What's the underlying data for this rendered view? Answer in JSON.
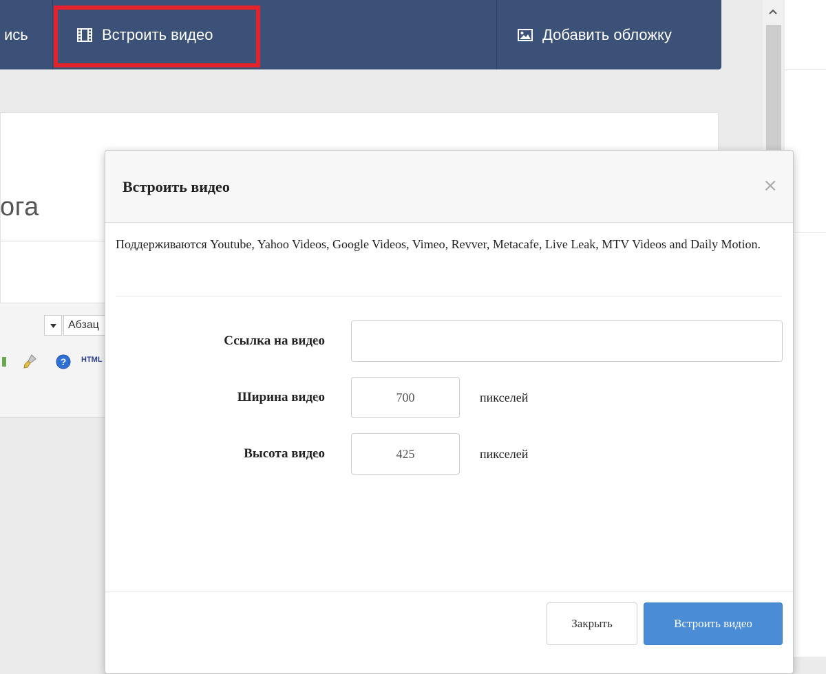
{
  "topbar": {
    "left_cut_label": "ись",
    "embed_video_label": "Встроить видео",
    "add_cover_label": "Добавить обложку"
  },
  "editor": {
    "title_fragment": "ога",
    "format_select_fragment": "Абзац",
    "html_label": "HTML"
  },
  "modal": {
    "title": "Встроить видео",
    "close_symbol": "×",
    "description": "Поддерживаются Youtube, Yahoo Videos, Google Videos, Vimeo, Revver, Metacafe, Live Leak, MTV Videos and Daily Motion.",
    "fields": {
      "url": {
        "label": "Ссылка на видео",
        "colon": ":",
        "value": "",
        "placeholder": ""
      },
      "width": {
        "label": "Ширина видео",
        "colon": ":",
        "value": "700",
        "unit": "пикселей"
      },
      "height": {
        "label": "Высота видео",
        "colon": ":",
        "value": "425",
        "unit": "пикселей"
      }
    },
    "buttons": {
      "close": "Закрыть",
      "embed": "Встроить видео"
    }
  },
  "colors": {
    "topbar_bg": "#3c5177",
    "highlight_border": "#e3222b",
    "primary_button": "#4a8cd6"
  },
  "icons": {
    "embed_video": "film-icon",
    "add_cover": "image-icon",
    "scroll_up": "chevron-up-icon"
  }
}
